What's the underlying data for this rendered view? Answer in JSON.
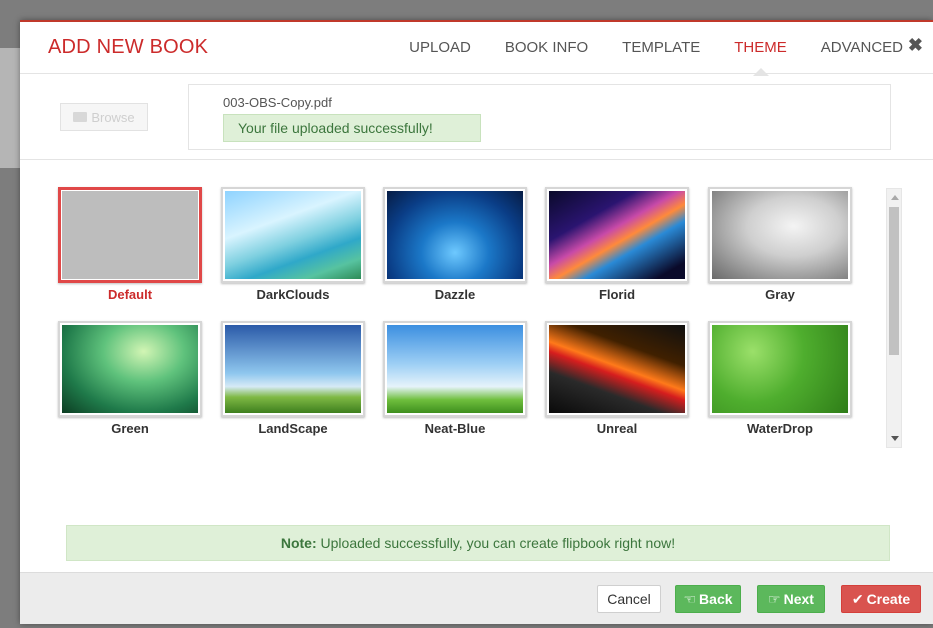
{
  "header": {
    "title": "ADD NEW BOOK",
    "tabs": [
      {
        "label": "UPLOAD",
        "active": false
      },
      {
        "label": "BOOK INFO",
        "active": false
      },
      {
        "label": "TEMPLATE",
        "active": false
      },
      {
        "label": "THEME",
        "active": true
      },
      {
        "label": "ADVANCED",
        "active": false
      }
    ],
    "close_icon": "close-icon"
  },
  "upload": {
    "browse_label": "Browse",
    "file_name": "003-OBS-Copy.pdf",
    "success_message": "Your file uploaded successfully!"
  },
  "themes": [
    {
      "label": "Default",
      "selected": true
    },
    {
      "label": "DarkClouds",
      "selected": false
    },
    {
      "label": "Dazzle",
      "selected": false
    },
    {
      "label": "Florid",
      "selected": false
    },
    {
      "label": "Gray",
      "selected": false
    },
    {
      "label": "Green",
      "selected": false
    },
    {
      "label": "LandScape",
      "selected": false
    },
    {
      "label": "Neat-Blue",
      "selected": false
    },
    {
      "label": "Unreal",
      "selected": false
    },
    {
      "label": "WaterDrop",
      "selected": false
    }
  ],
  "note": {
    "label": "Note:",
    "text": "Uploaded successfully, you can create flipbook right now!"
  },
  "footer": {
    "cancel": "Cancel",
    "back": "Back",
    "next": "Next",
    "create": "Create"
  },
  "colors": {
    "accent": "#cc2b2b",
    "success_bg": "#dff0d8",
    "success_text": "#3c763d",
    "button_green": "#5cb85c",
    "button_red": "#d9534f"
  }
}
